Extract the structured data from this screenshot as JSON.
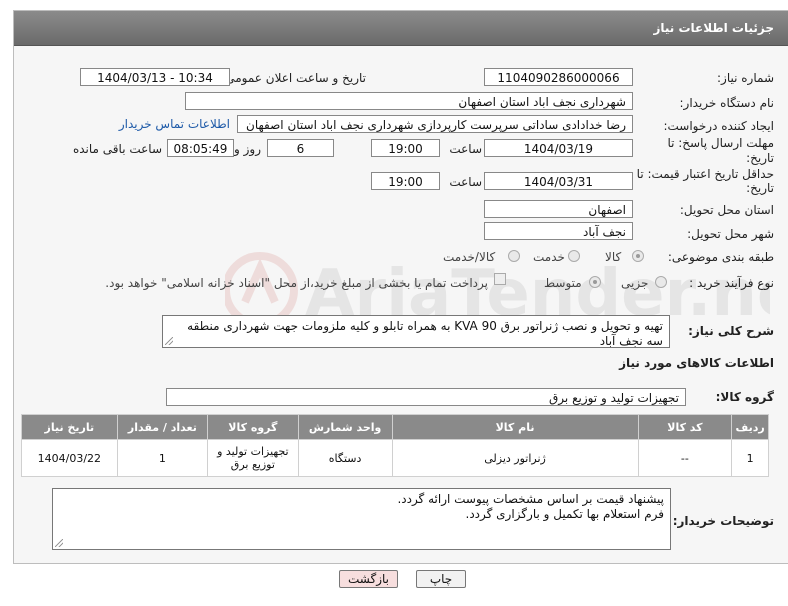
{
  "header": {
    "title": "جزئیات اطلاعات نیاز"
  },
  "labels": {
    "need_number": "شماره نیاز:",
    "announce_datetime": "تاریخ و ساعت اعلان عمومی:",
    "buyer_org": "نام دستگاه خریدار:",
    "requester": "ایجاد کننده درخواست:",
    "deadline": "مهلت ارسال پاسخ: تا تاریخ:",
    "min_validity": "حداقل تاریخ اعتبار قیمت: تا تاریخ:",
    "time": "ساعت",
    "days_and": "روز و",
    "hours_left": "ساعت باقی مانده",
    "province": "استان محل تحویل:",
    "city": "شهر محل تحویل:",
    "category": "طبقه بندی موضوعی:",
    "process_type": "نوع فرآیند خرید :",
    "description": "شرح کلی نیاز:",
    "goods_info": "اطلاعات کالاهای مورد نیاز",
    "goods_group": "گروه کالا:",
    "buyer_notes": "توضیحات خریدار:"
  },
  "values": {
    "need_number": "1104090286000066",
    "announce_datetime": "1404/03/13 - 10:34",
    "buyer_org": "شهرداری نجف اباد استان اصفهان",
    "requester": "رضا خدادادی ساداتی سرپرست  کارپردازی شهرداری نجف اباد استان اصفهان",
    "contact_link": "اطلاعات تماس خریدار",
    "deadline_date": "1404/03/19",
    "deadline_time": "19:00",
    "days_left": "6",
    "time_left": "08:05:49",
    "validity_date": "1404/03/31",
    "validity_time": "19:00",
    "province": "اصفهان",
    "city": "نجف آباد",
    "description": "تهیه و تحویل و نصب ژنراتور برق KVA 90 به همراه تابلو و کلیه ملزومات جهت شهرداری منطقه سه نجف آباد",
    "goods_group": "تجهیزات تولید و توزیع برق"
  },
  "category_options": [
    {
      "label": "کالا",
      "selected": true
    },
    {
      "label": "خدمت",
      "selected": false
    },
    {
      "label": "کالا/خدمت",
      "selected": false
    }
  ],
  "process_options": [
    {
      "label": "جزیی",
      "selected": false
    },
    {
      "label": "متوسط",
      "selected": true
    }
  ],
  "treasury_note": "پرداخت تمام یا بخشی از مبلغ خرید،از محل \"اسناد خزانه اسلامی\" خواهد بود.",
  "table": {
    "columns": [
      "ردیف",
      "کد کالا",
      "نام کالا",
      "واحد شمارش",
      "گروه کالا",
      "تعداد / مقدار",
      "تاریخ نیاز"
    ],
    "rows": [
      [
        "1",
        "--",
        "ژنراتور دیزلی",
        "دستگاه",
        "تجهیزات تولید و توزیع برق",
        "1",
        "1404/03/22"
      ]
    ]
  },
  "buyer_notes": [
    "پیشنهاد قیمت بر اساس مشخصات پیوست ارائه گردد.",
    "فرم استعلام بها تکمیل و بارگزاری گردد."
  ],
  "buttons": {
    "print": "چاپ",
    "back": "بازگشت"
  },
  "watermark": {
    "text": "AriaTender.net"
  },
  "colors": {
    "header": "#7a7a7a",
    "link": "#1e5aa8",
    "back_button": "#f7dede"
  }
}
